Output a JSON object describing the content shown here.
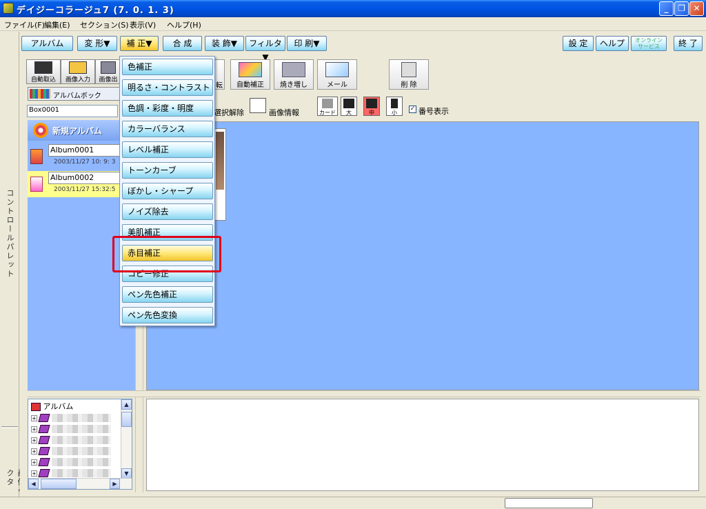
{
  "window": {
    "title": "デイジーコラージュ7 (7. 0. 1. 3)"
  },
  "menubar": [
    "ファイル(F)",
    "編集(E)",
    "セクション(S)",
    "表示(V)",
    "ヘルプ(H)"
  ],
  "side_strip": {
    "top_label": "コントロールパレット",
    "bottom_label": "画像セレクタ"
  },
  "tabs": {
    "album": "アルバム",
    "transform": "変 形▼",
    "correct": "補 正▼",
    "composite": "合 成",
    "decorate": "装 飾▼",
    "filter": "フィルタ▼",
    "print": "印 刷▼",
    "settings": "設 定",
    "help": "ヘルプ",
    "online": "オンライン サービス",
    "exit": "終 了"
  },
  "left_tools": {
    "auto_import": "自動取込",
    "image_input": "画像入力",
    "image_output": "画像出",
    "album_box": "アルバムボック"
  },
  "box_field": "Box0001",
  "new_album": "新規アルバム",
  "albums": [
    {
      "name": "Album0001",
      "date": "2003/11/27 10: 9: 3"
    },
    {
      "name": "Album0002",
      "date": "2003/11/27 15:32:5"
    }
  ],
  "right_tools": {
    "rotate": "転",
    "auto_correct": "自動補正",
    "reprint": "焼き増し",
    "mail": "メール",
    "delete": "削 除"
  },
  "viewbar": {
    "deselect": "選択解除",
    "image_info": "画像情報",
    "card": "カード",
    "large": "大",
    "medium": "中",
    "small": "小",
    "show_numbers": "番号表示",
    "show_numbers_checked": "✓"
  },
  "tree": {
    "root": "アルバム"
  },
  "dropdown": [
    "色補正",
    "明るさ・コントラスト",
    "色調・彩度・明度",
    "カラーバランス",
    "レベル補正",
    "トーンカーブ",
    "ぼかし・シャープ",
    "ノイズ除去",
    "美肌補正",
    "赤目補正",
    "コピー修正",
    "ペン先色補正",
    "ペン先色変換"
  ],
  "dropdown_highlight_index": 9,
  "colors": {
    "titlebar": "#0054e3",
    "canvas": "#88b5ff",
    "highlight_box": "#e0001b",
    "selected_album": "#ffff8c"
  }
}
